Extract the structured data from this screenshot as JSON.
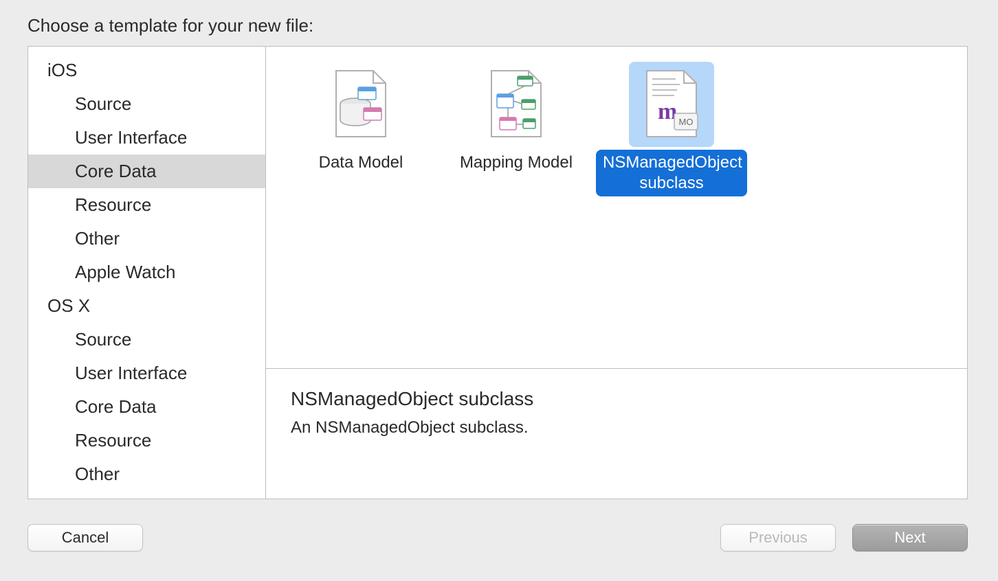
{
  "title": "Choose a template for your new file:",
  "sidebar": {
    "sections": [
      {
        "header": "iOS",
        "items": [
          {
            "label": "Source",
            "selected": false
          },
          {
            "label": "User Interface",
            "selected": false
          },
          {
            "label": "Core Data",
            "selected": true
          },
          {
            "label": "Resource",
            "selected": false
          },
          {
            "label": "Other",
            "selected": false
          },
          {
            "label": "Apple Watch",
            "selected": false
          }
        ]
      },
      {
        "header": "OS X",
        "items": [
          {
            "label": "Source",
            "selected": false
          },
          {
            "label": "User Interface",
            "selected": false
          },
          {
            "label": "Core Data",
            "selected": false
          },
          {
            "label": "Resource",
            "selected": false
          },
          {
            "label": "Other",
            "selected": false
          }
        ]
      }
    ]
  },
  "templates": {
    "items": [
      {
        "label": "Data Model",
        "icon": "data-model-icon",
        "selected": false
      },
      {
        "label": "Mapping Model",
        "icon": "mapping-model-icon",
        "selected": false
      },
      {
        "label": "NSManagedObject subclass",
        "icon": "managed-object-icon",
        "selected": true
      }
    ]
  },
  "detail": {
    "title": "NSManagedObject subclass",
    "description": "An NSManagedObject subclass."
  },
  "buttons": {
    "cancel": "Cancel",
    "previous": "Previous",
    "next": "Next"
  }
}
